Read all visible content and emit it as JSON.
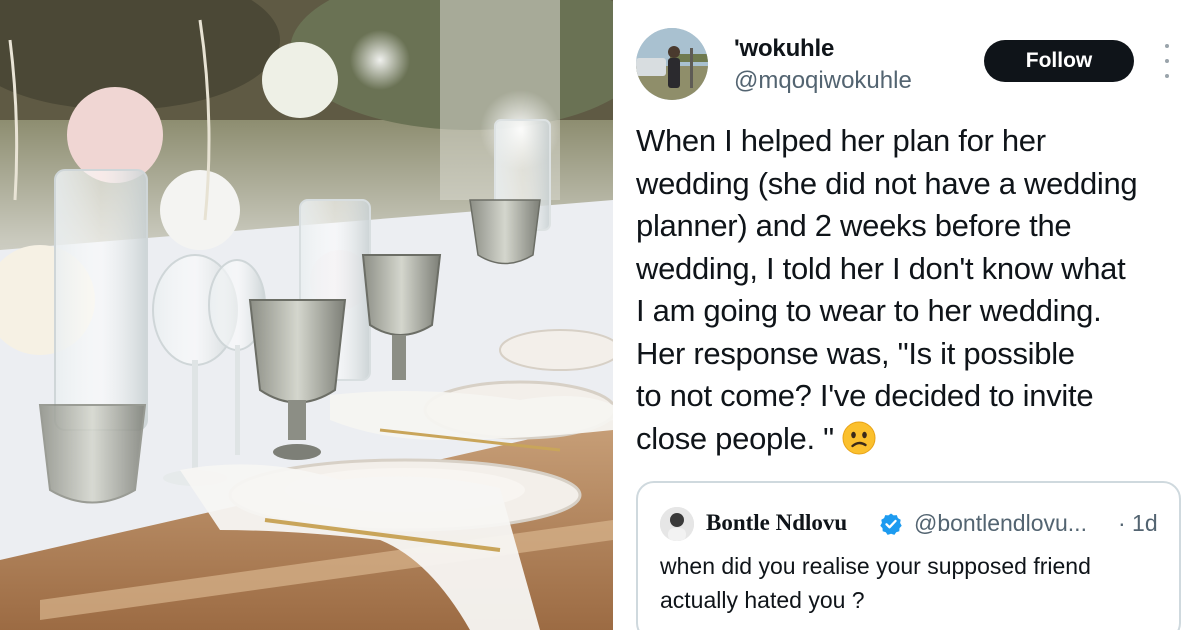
{
  "photo": {
    "description_icon": "wedding-table-photo"
  },
  "tweet": {
    "display_name": "'wokuhle",
    "handle": "@mqoqiwokuhle",
    "follow_label": "Follow",
    "text_lines": [
      "When I helped her plan for her",
      "wedding (she did not have a wedding",
      "planner) and 2 weeks before the",
      "wedding, I told her I don't know what",
      "I am going to wear to her wedding.",
      "Her response was, \"Is it possible",
      "to not come? I've decided to invite",
      "close people. \""
    ],
    "emoji": "confused-face-emoji"
  },
  "quote": {
    "name": "Bontle Ndlovu",
    "handle": "@bontlendlovu...",
    "time": "· 1d",
    "text_lines": [
      "when did you realise your supposed friend",
      "actually hated you ?"
    ]
  },
  "colors": {
    "text_primary": "#0f1419",
    "text_secondary": "#536471",
    "follow_bg": "#0f1419",
    "verified": "#1d9bf0",
    "card_border": "#cfd9de"
  }
}
